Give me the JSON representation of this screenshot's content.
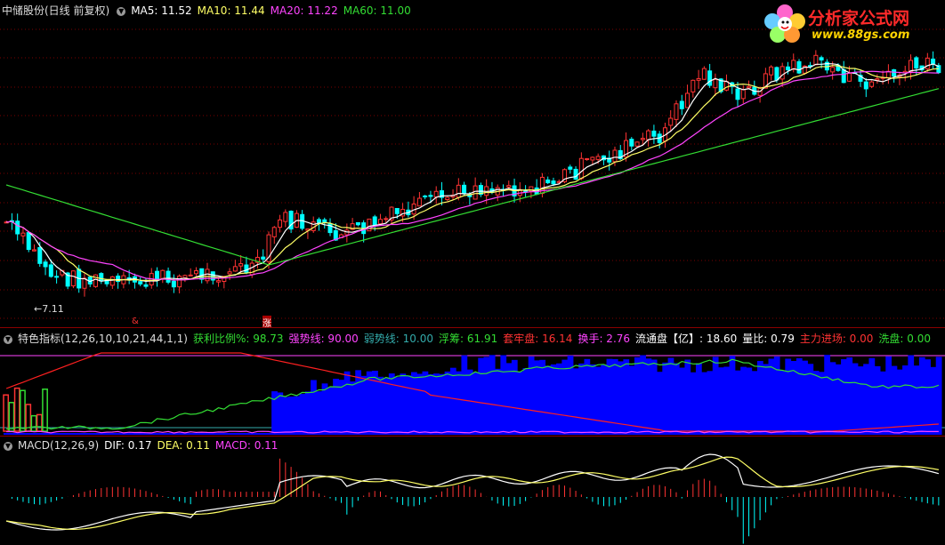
{
  "main": {
    "stock_title": "中储股份(日线 前复权)",
    "ma_labels": [
      {
        "text": "MA5: 11.52",
        "color": "#ffffff"
      },
      {
        "text": "MA10: 11.44",
        "color": "#ffff66"
      },
      {
        "text": "MA20: 11.22",
        "color": "#ff44ff"
      },
      {
        "text": "MA60: 11.00",
        "color": "#33dd33"
      }
    ],
    "low_label": "←7.11",
    "mark_a": "&",
    "mark_b": "涨"
  },
  "logo": {
    "title": "分析家公式网",
    "url": "www.88gs.com"
  },
  "indicator": {
    "name": "特色指标(12,26,10,10,21,44,1,1)",
    "items": [
      {
        "text": "获利比例%: 98.73",
        "color": "#33dd33"
      },
      {
        "text": "强势线: 90.00",
        "color": "#ff44ff"
      },
      {
        "text": "弱势线: 10.00",
        "color": "#33aaaa"
      },
      {
        "text": "浮筹: 61.91",
        "color": "#33dd33"
      },
      {
        "text": "套牢盘: 16.14",
        "color": "#ff3333"
      },
      {
        "text": "换手: 2.76",
        "color": "#ff44ff"
      },
      {
        "text": "流通盘【亿】: 18.60",
        "color": "#ffffff"
      },
      {
        "text": "量比: 0.79",
        "color": "#ffffff"
      },
      {
        "text": "主力进场: 0.00",
        "color": "#ff3333"
      },
      {
        "text": "洗盘: 0.00",
        "color": "#33dd33"
      }
    ]
  },
  "macd": {
    "name": "MACD(12,26,9)",
    "items": [
      {
        "text": "DIF: 0.17",
        "color": "#ffffff"
      },
      {
        "text": "DEA: 0.11",
        "color": "#ffff66"
      },
      {
        "text": "MACD: 0.11",
        "color": "#ff44ff"
      }
    ]
  },
  "colors": {
    "up": "#ff3333",
    "down": "#00ffff",
    "ma5": "#ffffff",
    "ma10": "#ffff66",
    "ma20": "#ff44ff",
    "ma60": "#33dd33",
    "profit_fill": "#0000ff",
    "trapped_line": "#ff2020",
    "float_line": "#33dd33"
  }
}
